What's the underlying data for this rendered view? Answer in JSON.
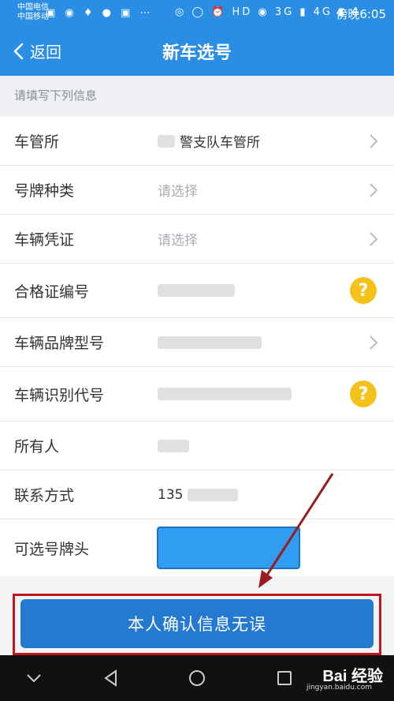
{
  "status_bar": {
    "carrier_1": "中国电信",
    "carrier_2": "中国移动",
    "left_icons": "▣ ◉ ♦ ● ▣ ⋯",
    "right_icons": "◎ ◯ ⏰ HD ◉ 3G ▮ 4G ▮ 4",
    "time": "傍晚6:05",
    "battery_level": "4"
  },
  "nav": {
    "back_label": "返回",
    "title": "新车选号"
  },
  "hint": "请填写下列信息",
  "form": {
    "rows": [
      {
        "label": "车管所",
        "value": "警支队车管所"
      },
      {
        "label": "号牌种类",
        "value": "请选择"
      },
      {
        "label": "车辆凭证",
        "value": "请选择"
      },
      {
        "label": "合格证编号",
        "value": ""
      },
      {
        "label": "车辆品牌型号",
        "value": ""
      },
      {
        "label": "车辆识别代号",
        "value": ""
      },
      {
        "label": "所有人",
        "value": ""
      },
      {
        "label": "联系方式",
        "value": "135"
      },
      {
        "label": "可选号牌头",
        "value": ""
      }
    ]
  },
  "confirm_button": "本人确认信息无误",
  "watermark": {
    "logo": "Bai 经验",
    "url": "jingyan.baidu.com"
  },
  "colors": {
    "primary": "#2a8ee4",
    "button": "#2479d1",
    "highlight": "#c2151f",
    "help": "#f5c21b"
  }
}
